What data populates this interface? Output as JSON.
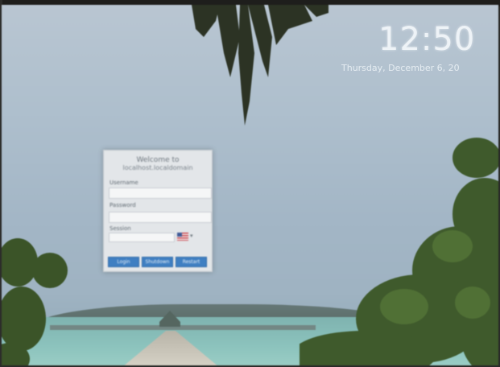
{
  "lockscreen": {
    "time": "12:50",
    "date": "Thursday, December 6, 20"
  },
  "login": {
    "welcome_line1": "Welcome to",
    "welcome_line2": "localhost.localdomain",
    "username_label": "Username",
    "username_value": "",
    "password_label": "Password",
    "password_value": "",
    "session_label": "Session",
    "session_value": "",
    "buttons": {
      "login": "Login",
      "shutdown": "Shutdown",
      "restart": "Restart"
    }
  },
  "colors": {
    "accent": "#3f7fc2",
    "panel": "#e3e6e9"
  },
  "icons": {
    "language_flag": "us-flag-icon",
    "dropdown": "chevron-down-icon"
  }
}
